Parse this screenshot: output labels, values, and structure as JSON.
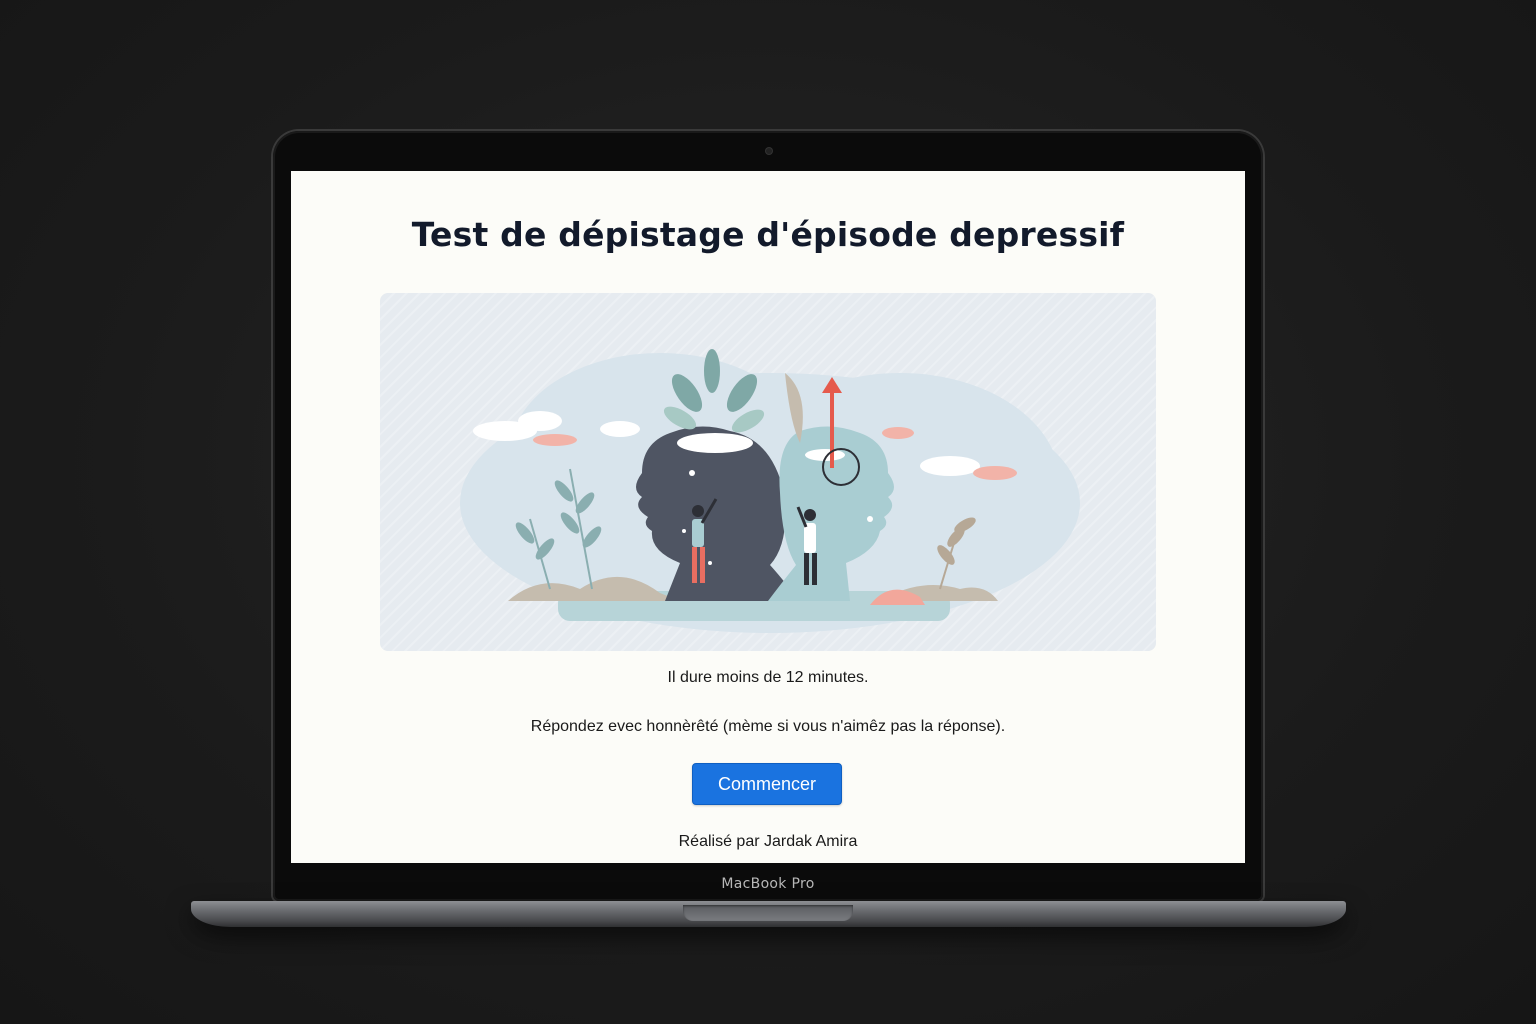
{
  "device": {
    "brand_label": "MacBook Pro"
  },
  "page": {
    "title": "Test de dépistage d'épisode depressif",
    "duration_text": "Il dure moins de 12 minutes.",
    "instruction_text": "Répondez evec honnèrêté (mème si vous n'aimêz pas la réponse).",
    "start_button_label": "Commencer",
    "credit_text": "Réalisé par Jardak Amira"
  },
  "colors": {
    "accent": "#1a73e0",
    "title": "#121a2b",
    "screen_bg": "#fcfcf8",
    "illustration_bg": "#e6ebf0"
  }
}
